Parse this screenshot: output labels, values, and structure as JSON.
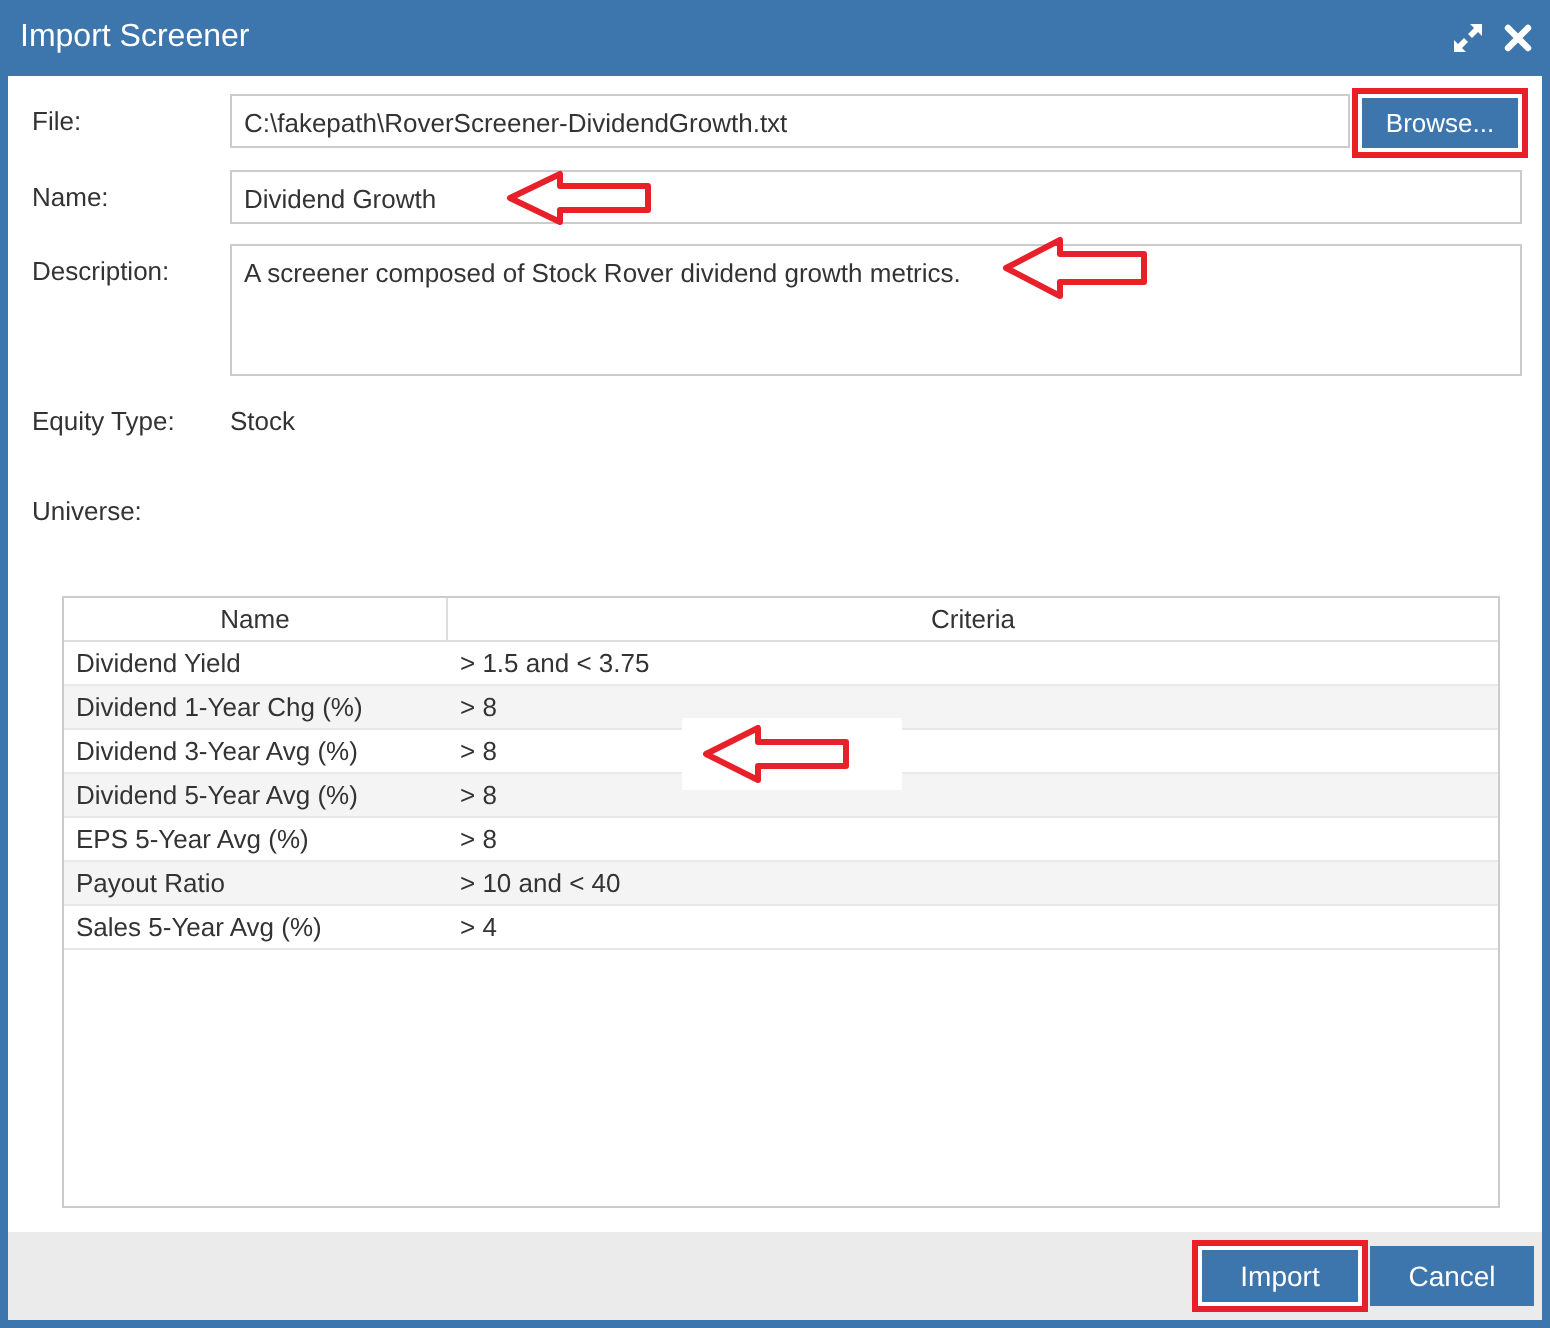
{
  "window": {
    "title": "Import Screener"
  },
  "form": {
    "file": {
      "label": "File:",
      "value": "C:\\fakepath\\RoverScreener-DividendGrowth.txt",
      "browse_button": {
        "label": "Browse...",
        "highlighted": true
      }
    },
    "name": {
      "label": "Name:",
      "value": "Dividend Growth",
      "annotated": true
    },
    "description": {
      "label": "Description:",
      "value": "A screener composed of Stock Rover dividend growth metrics.",
      "annotated": true
    },
    "equity_type": {
      "label": "Equity Type:",
      "value": "Stock"
    },
    "universe": {
      "label": "Universe:"
    }
  },
  "table": {
    "annotated": true,
    "columns": [
      "Name",
      "Criteria"
    ],
    "rows": [
      {
        "name": "Dividend Yield",
        "criteria": "> 1.5 and < 3.75"
      },
      {
        "name": "Dividend 1-Year Chg (%)",
        "criteria": "> 8"
      },
      {
        "name": "Dividend 3-Year Avg (%)",
        "criteria": "> 8"
      },
      {
        "name": "Dividend 5-Year Avg (%)",
        "criteria": "> 8"
      },
      {
        "name": "EPS 5-Year Avg (%)",
        "criteria": "> 8"
      },
      {
        "name": "Payout Ratio",
        "criteria": "> 10 and < 40"
      },
      {
        "name": "Sales 5-Year Avg (%)",
        "criteria": "> 4"
      }
    ]
  },
  "buttons": [
    {
      "label": "Import",
      "highlighted": true
    },
    {
      "label": "Cancel",
      "highlighted": false
    }
  ]
}
